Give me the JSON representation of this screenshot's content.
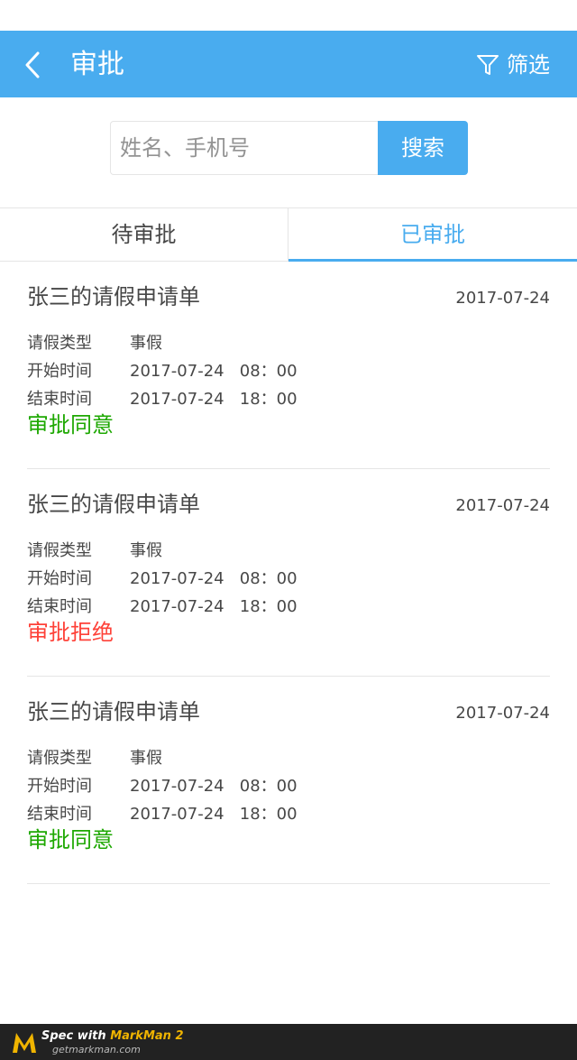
{
  "header": {
    "title": "审批",
    "filter_label": "筛选"
  },
  "search": {
    "placeholder": "姓名、手机号",
    "value": "",
    "button_label": "搜索"
  },
  "tabs": [
    {
      "label": "待审批",
      "active": false
    },
    {
      "label": "已审批",
      "active": true
    }
  ],
  "records": [
    {
      "title": "张三的请假申请单",
      "date": "2017-07-24",
      "type_label": "请假类型",
      "type_value": "事假",
      "start_label": "开始时间",
      "start_value": "2017-07-24   08：00",
      "end_label": "结束时间",
      "end_value": "2017-07-24   18：00",
      "status": "审批同意",
      "status_kind": "approve"
    },
    {
      "title": "张三的请假申请单",
      "date": "2017-07-24",
      "type_label": "请假类型",
      "type_value": "事假",
      "start_label": "开始时间",
      "start_value": "2017-07-24   08：00",
      "end_label": "结束时间",
      "end_value": "2017-07-24   18：00",
      "status": "审批拒绝",
      "status_kind": "reject"
    },
    {
      "title": "张三的请假申请单",
      "date": "2017-07-24",
      "type_label": "请假类型",
      "type_value": "事假",
      "start_label": "开始时间",
      "start_value": "2017-07-24   08：00",
      "end_label": "结束时间",
      "end_value": "2017-07-24   18：00",
      "status": "审批同意",
      "status_kind": "approve"
    }
  ],
  "footer": {
    "prefix": "Spec with ",
    "brand": "MarkMan 2",
    "url": "getmarkman.com"
  },
  "colors": {
    "primary": "#49acef",
    "text": "#474747",
    "placeholder": "#939393",
    "approve": "#1ea802",
    "reject": "#fe4138"
  }
}
